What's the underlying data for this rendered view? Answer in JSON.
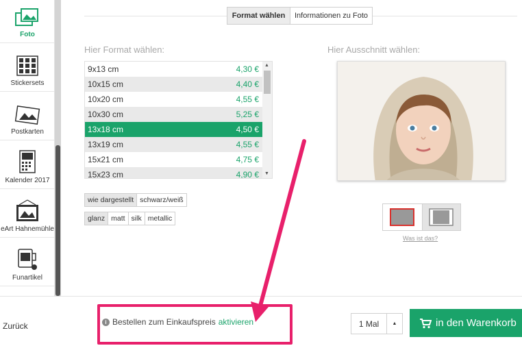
{
  "sidebar": {
    "items": [
      {
        "label": "Foto",
        "icon": "photo-icon",
        "active": true
      },
      {
        "label": "Stickersets",
        "icon": "stickers-icon"
      },
      {
        "label": "Postkarten",
        "icon": "postcard-icon"
      },
      {
        "label": "Kalender 2017",
        "icon": "calendar-icon"
      },
      {
        "label": "eArt Hahnemühle",
        "icon": "art-print-icon"
      },
      {
        "label": "Funartikel",
        "icon": "mug-icon"
      }
    ]
  },
  "tabs": [
    {
      "label": "Format wählen",
      "active": true
    },
    {
      "label": "Informationen zu Foto"
    }
  ],
  "format_section": {
    "title": "Hier Format wählen:",
    "rows": [
      {
        "size": "9x13 cm",
        "price": "4,30 €"
      },
      {
        "size": "10x15 cm",
        "price": "4,40 €"
      },
      {
        "size": "10x20 cm",
        "price": "4,55 €"
      },
      {
        "size": "10x30 cm",
        "price": "5,25 €"
      },
      {
        "size": "13x18 cm",
        "price": "4,50 €",
        "selected": true
      },
      {
        "size": "13x19 cm",
        "price": "4,55 €"
      },
      {
        "size": "15x21 cm",
        "price": "4,75 €"
      },
      {
        "size": "15x23 cm",
        "price": "4,90 €"
      }
    ],
    "color_options": [
      "wie dargestellt",
      "schwarz/weiß"
    ],
    "finish_options": [
      "glanz",
      "matt",
      "silk",
      "metallic"
    ]
  },
  "crop_section": {
    "title": "Hier Ausschnitt wählen:",
    "help_link": "Was ist das?"
  },
  "bottom": {
    "back_label": "Zurück",
    "promo_text": "Bestellen zum Einkaufspreis",
    "promo_link": "aktivieren",
    "quantity": "1 Mal",
    "cart_label": "in den Warenkorb"
  },
  "colors": {
    "accent": "#1aa36a",
    "annotation": "#e8206b"
  }
}
